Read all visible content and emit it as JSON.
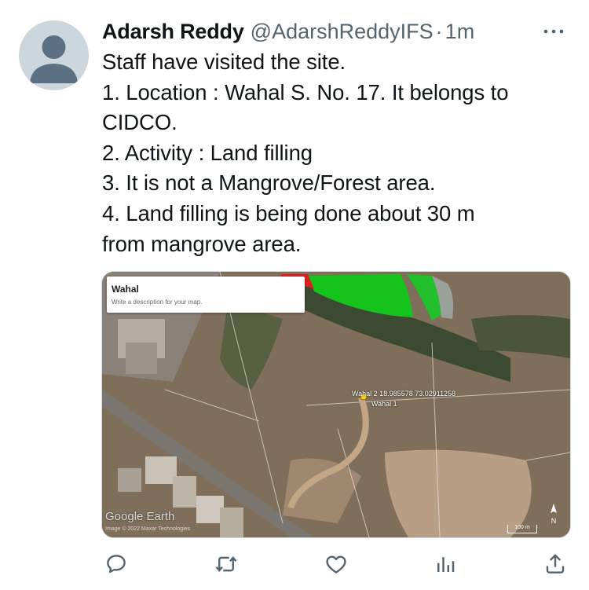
{
  "tweet": {
    "author_name": "Adarsh Reddy",
    "author_handle": "@AdarshReddyIFS",
    "separator": "·",
    "time": "1m",
    "lines": [
      "Staff have visited the site.",
      "1.  Location : Wahal S. No. 17. It belongs to",
      "CIDCO.",
      "2.  Activity : Land filling",
      "3.  It is not a Mangrove/Forest area.",
      "4.  Land filling is being done about 30 m",
      "from mangrove area."
    ]
  },
  "media": {
    "map_title": "Wahal",
    "map_description": "Write a description for your map.",
    "pin_label_1": "Wahal 2  18.985578 73.02911258",
    "pin_label_2": "Wahal 1",
    "logo_text": "Google Earth",
    "credit_text": "Image © 2022 Maxar Technologies",
    "scale_text": "100 m"
  },
  "colors": {
    "text": "#0f1419",
    "secondary": "#536471",
    "avatar": "#ccd6dd",
    "icon": "#536471"
  },
  "icons": {
    "more": "more-horizontal-icon",
    "reply": "reply-icon",
    "retweet": "retweet-icon",
    "like": "heart-icon",
    "views": "analytics-icon",
    "share": "share-icon"
  }
}
